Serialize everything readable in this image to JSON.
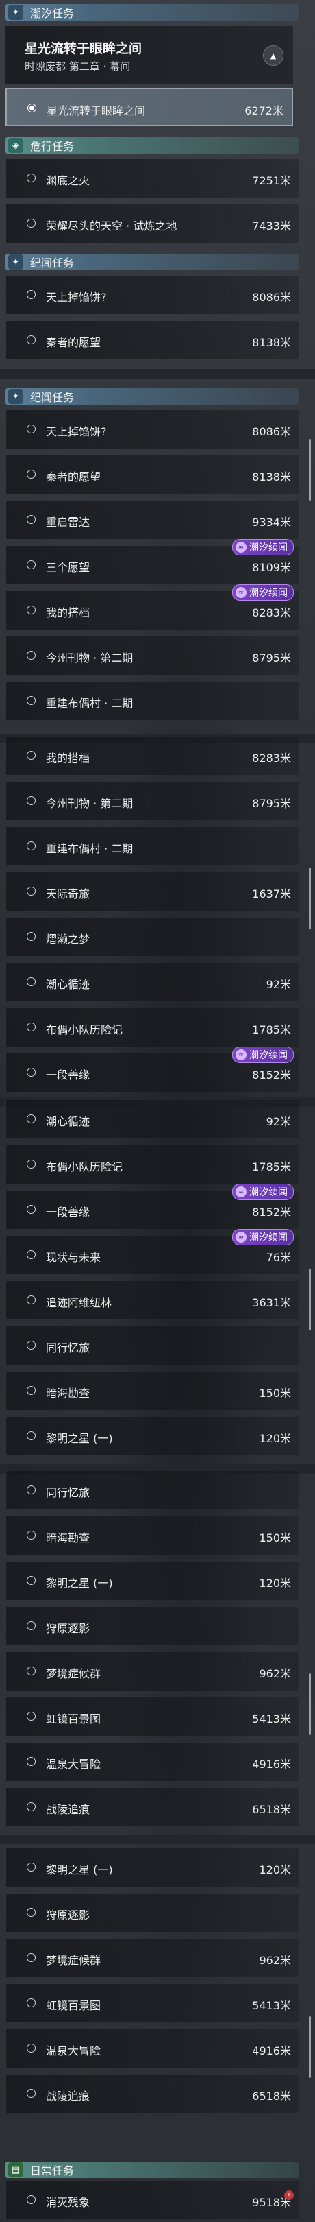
{
  "sections": {
    "tide_tasks": "潮汐任务",
    "hazard_tasks": "危行任务",
    "tale_tasks": "纪闻任务",
    "daily_tasks": "日常任务"
  },
  "current_quest": {
    "title": "星光流转于眼眸之间",
    "subtitle": "时隙废都 第二章 · 幕间",
    "objective": "星光流转于眼眸之间",
    "distance": "6272米"
  },
  "badge_label": "潮汐续闻",
  "hazard_items": [
    {
      "name": "渊底之火",
      "dist": "7251米"
    },
    {
      "name": "荣耀尽头的天空 · 试炼之地",
      "dist": "7433米"
    }
  ],
  "tale_preview": [
    {
      "name": "天上掉馅饼?",
      "dist": "8086米"
    },
    {
      "name": "秦者的愿望",
      "dist": "8138米"
    }
  ],
  "page2": [
    {
      "name": "天上掉馅饼?",
      "dist": "8086米"
    },
    {
      "name": "秦者的愿望",
      "dist": "8138米"
    },
    {
      "name": "重启雷达",
      "dist": "9334米"
    },
    {
      "name": "三个愿望",
      "dist": "8109米"
    },
    {
      "name": "我的搭档",
      "dist": "8283米"
    },
    {
      "name": "今州刊物 · 第二期",
      "dist": "8795米"
    },
    {
      "name": "重建布偶村 · 二期",
      "dist": ""
    }
  ],
  "page3": [
    {
      "name": "我的搭档",
      "dist": "8283米"
    },
    {
      "name": "今州刊物 · 第二期",
      "dist": "8795米"
    },
    {
      "name": "重建布偶村 · 二期",
      "dist": ""
    },
    {
      "name": "天际奇旅",
      "dist": "1637米"
    },
    {
      "name": "熠濑之梦",
      "dist": ""
    },
    {
      "name": "潮心循迹",
      "dist": "92米"
    },
    {
      "name": "布偶小队历险记",
      "dist": "1785米"
    },
    {
      "name": "一段善缘",
      "dist": "8152米"
    }
  ],
  "page4": [
    {
      "name": "潮心循迹",
      "dist": "92米"
    },
    {
      "name": "布偶小队历险记",
      "dist": "1785米"
    },
    {
      "name": "一段善缘",
      "dist": "8152米"
    },
    {
      "name": "现状与未来",
      "dist": "76米"
    },
    {
      "name": "追迹阿维纽林",
      "dist": "3631米"
    },
    {
      "name": "同行忆旅",
      "dist": ""
    },
    {
      "name": "暗海勘查",
      "dist": "150米"
    },
    {
      "name": "黎明之星 (一)",
      "dist": "120米"
    }
  ],
  "page5": [
    {
      "name": "同行忆旅",
      "dist": ""
    },
    {
      "name": "暗海勘查",
      "dist": "150米"
    },
    {
      "name": "黎明之星 (一)",
      "dist": "120米"
    },
    {
      "name": "狩原逐影",
      "dist": ""
    },
    {
      "name": "梦境症候群",
      "dist": "962米"
    },
    {
      "name": "虹镜百景图",
      "dist": "5413米"
    },
    {
      "name": "温泉大冒险",
      "dist": "4916米"
    },
    {
      "name": "战陵追痕",
      "dist": "6518米"
    }
  ],
  "page6": [
    {
      "name": "黎明之星 (一)",
      "dist": "120米"
    },
    {
      "name": "狩原逐影",
      "dist": ""
    },
    {
      "name": "梦境症候群",
      "dist": "962米"
    },
    {
      "name": "虹镜百景图",
      "dist": "5413米"
    },
    {
      "name": "温泉大冒险",
      "dist": "4916米"
    },
    {
      "name": "战陵追痕",
      "dist": "6518米"
    }
  ],
  "daily_items": [
    {
      "name": "消灭残象",
      "dist": "9518米"
    }
  ],
  "colors": {
    "tide_header": "#5c7f98",
    "hazard_header": "#5a8e8a",
    "badge": "#7c46c7"
  }
}
